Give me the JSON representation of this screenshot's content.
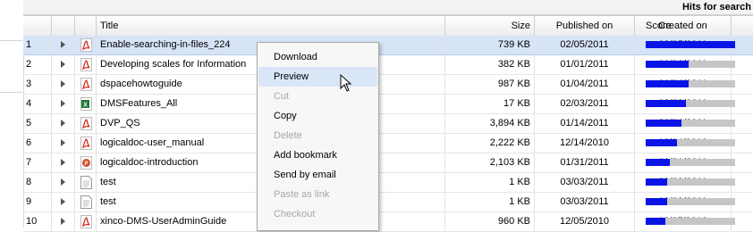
{
  "header": {
    "hits_label": "Hits for search"
  },
  "columns": {
    "title": "Title",
    "size": "Size",
    "published": "Published on",
    "created": "Created on",
    "score": "Score"
  },
  "rows": [
    {
      "num": "1",
      "icon": "pdf-icon",
      "title": "Enable-searching-in-files_224",
      "size": "739 KB",
      "published": "02/05/2011",
      "created": "02/05/2011",
      "score": 1.0,
      "selected": true
    },
    {
      "num": "2",
      "icon": "pdf-icon",
      "title": "Developing scales for Information",
      "size": "382 KB",
      "published": "01/01/2011",
      "created": "01/01/2011",
      "score": 0.48
    },
    {
      "num": "3",
      "icon": "pdf-icon",
      "title": "dspacehowtoguide",
      "size": "987 KB",
      "published": "01/04/2011",
      "created": "01/04/2011",
      "score": 0.48
    },
    {
      "num": "4",
      "icon": "excel-icon",
      "title": "DMSFeatures_All",
      "size": "17 KB",
      "published": "02/03/2011",
      "created": "02/03/2011",
      "score": 0.45
    },
    {
      "num": "5",
      "icon": "pdf-icon",
      "title": "DVP_QS",
      "size": "3,894 KB",
      "published": "01/14/2011",
      "created": "01/14/2011",
      "score": 0.4
    },
    {
      "num": "6",
      "icon": "pdf-icon",
      "title": "logicaldoc-user_manual",
      "size": "2,222 KB",
      "published": "12/14/2010",
      "created": "12/14/2010",
      "score": 0.35
    },
    {
      "num": "7",
      "icon": "powerpoint-icon",
      "title": "logicaldoc-introduction",
      "size": "2,103 KB",
      "published": "01/31/2011",
      "created": "01/31/2011",
      "score": 0.27
    },
    {
      "num": "8",
      "icon": "text-file-icon",
      "title": "test",
      "size": "1 KB",
      "published": "03/03/2011",
      "created": "03/03/2011",
      "score": 0.24
    },
    {
      "num": "9",
      "icon": "text-file-icon",
      "title": "test",
      "size": "1 KB",
      "published": "03/03/2011",
      "created": "03/03/2011",
      "score": 0.24
    },
    {
      "num": "10",
      "icon": "pdf-icon",
      "title": "xinco-DMS-UserAdminGuide",
      "size": "960 KB",
      "published": "12/05/2010",
      "created": "12/05/2010",
      "score": 0.22
    }
  ],
  "context_menu": [
    {
      "label": "Download",
      "disabled": false
    },
    {
      "label": "Preview",
      "disabled": false,
      "highlighted": true
    },
    {
      "label": "Cut",
      "disabled": true
    },
    {
      "label": "Copy",
      "disabled": false
    },
    {
      "label": "Delete",
      "disabled": true
    },
    {
      "label": "Add bookmark",
      "disabled": false
    },
    {
      "label": "Send by email",
      "disabled": false
    },
    {
      "label": "Paste as link",
      "disabled": true
    },
    {
      "label": "Checkout",
      "disabled": true
    }
  ],
  "colors": {
    "score_fill": "#0a14e6",
    "score_track": "#c6c6c6",
    "selected_row": "#d7e3f7",
    "pdf_red": "#d42a1e"
  }
}
